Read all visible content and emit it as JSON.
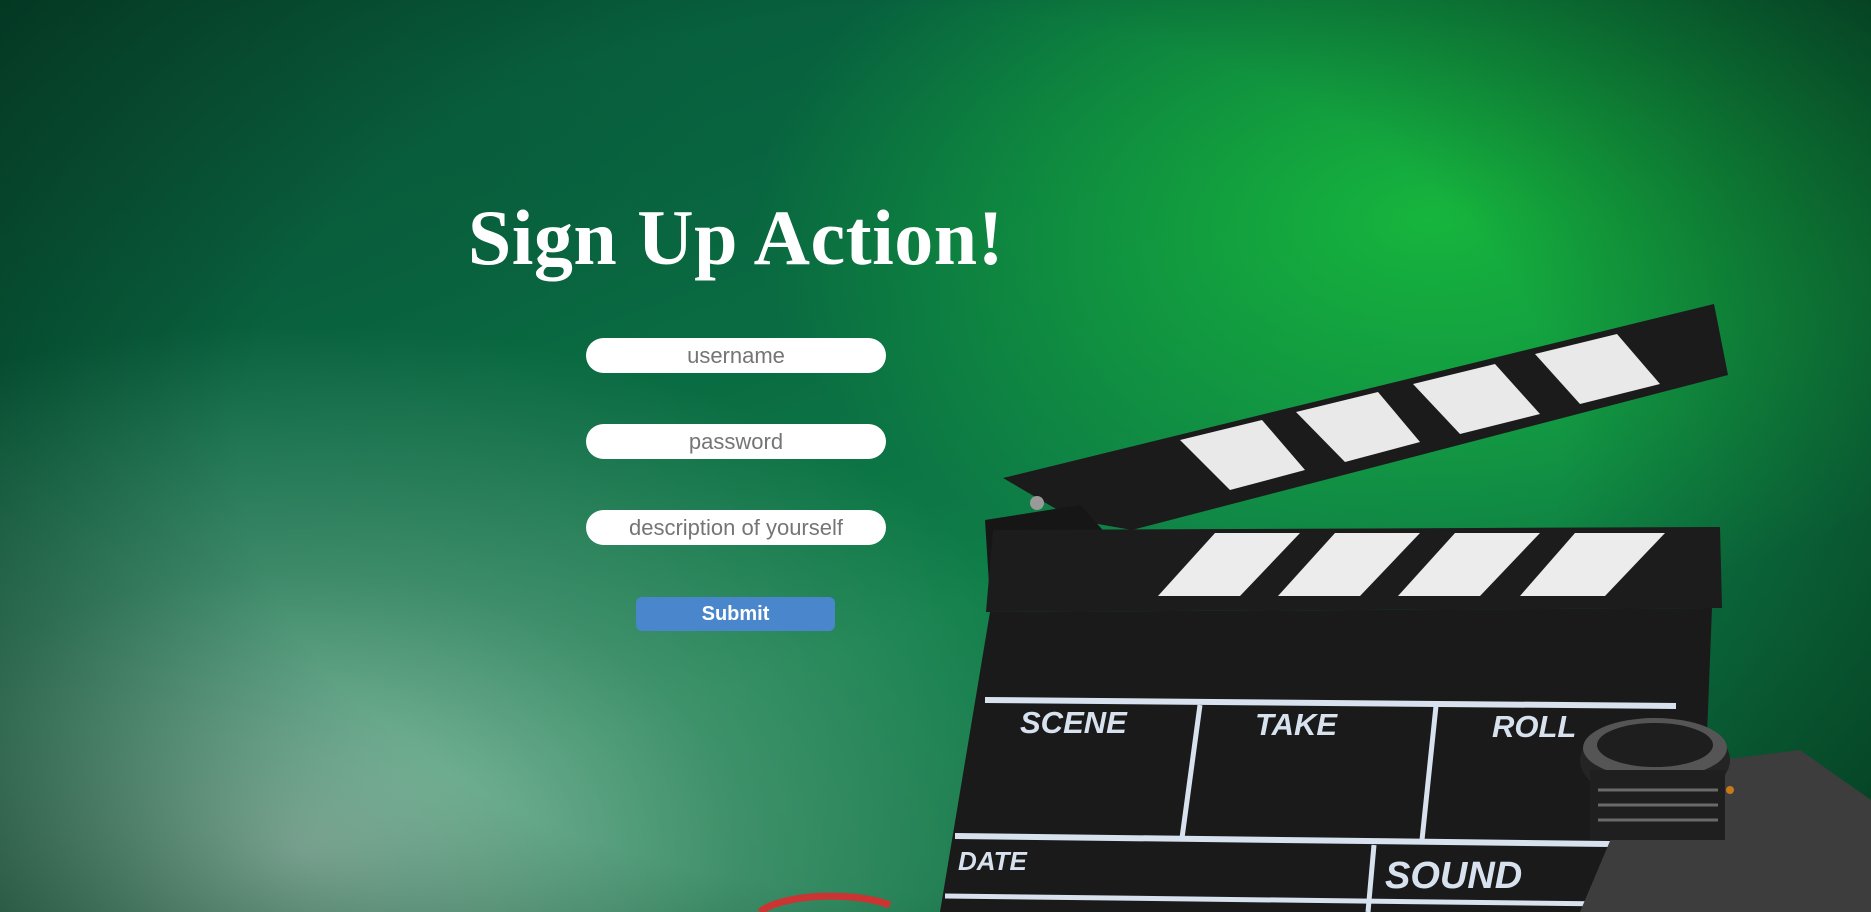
{
  "page": {
    "title": "Sign Up Action!"
  },
  "form": {
    "username": {
      "placeholder": "username",
      "value": ""
    },
    "password": {
      "placeholder": "password",
      "value": ""
    },
    "description": {
      "placeholder": "description of yourself",
      "value": ""
    },
    "submit_label": "Submit"
  },
  "background": {
    "image": "film-clapperboard-and-camera-lens-on-green-smoky-backdrop",
    "clapperboard": {
      "scene_label": "SCENE",
      "take_label": "TAKE",
      "roll_label": "ROLL",
      "date_label": "DATE",
      "sound_label": "SOUND"
    }
  },
  "colors": {
    "background_green": "#0a6c42",
    "submit_blue": "#4a86cc",
    "title_white": "#ffffff"
  }
}
